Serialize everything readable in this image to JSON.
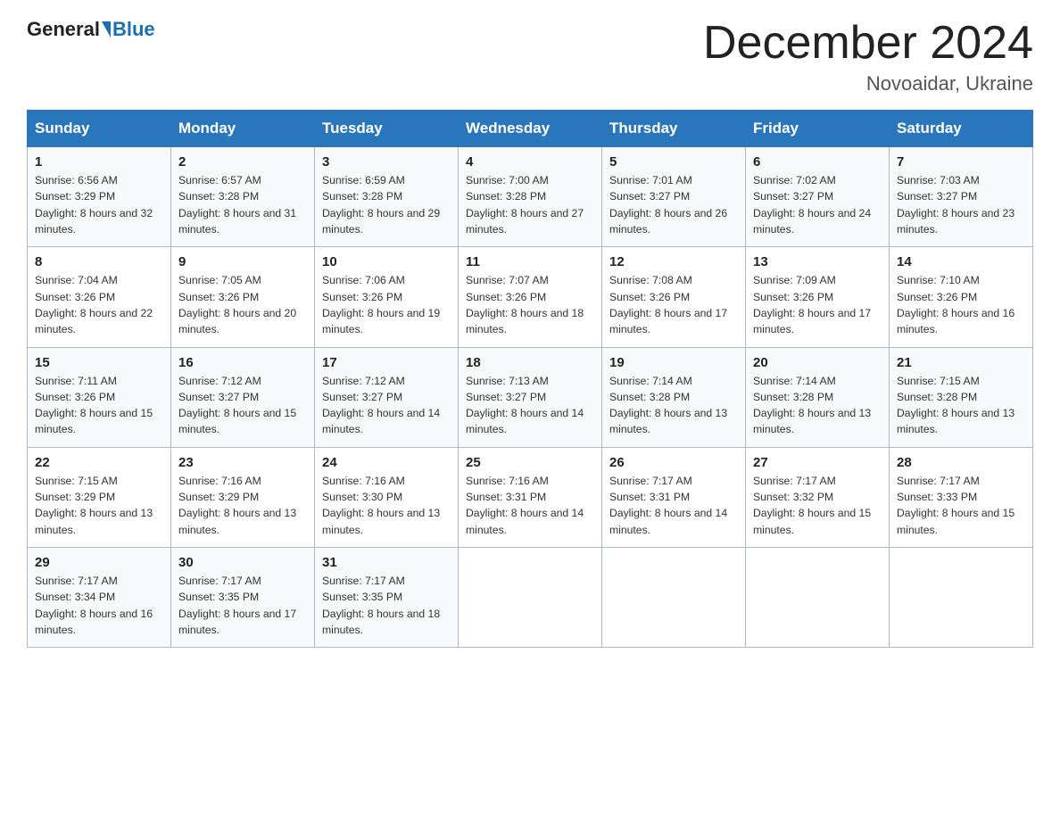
{
  "logo": {
    "general": "General",
    "blue": "Blue"
  },
  "title": "December 2024",
  "location": "Novoaidar, Ukraine",
  "weekdays": [
    "Sunday",
    "Monday",
    "Tuesday",
    "Wednesday",
    "Thursday",
    "Friday",
    "Saturday"
  ],
  "weeks": [
    [
      {
        "day": "1",
        "sunrise": "Sunrise: 6:56 AM",
        "sunset": "Sunset: 3:29 PM",
        "daylight": "Daylight: 8 hours and 32 minutes."
      },
      {
        "day": "2",
        "sunrise": "Sunrise: 6:57 AM",
        "sunset": "Sunset: 3:28 PM",
        "daylight": "Daylight: 8 hours and 31 minutes."
      },
      {
        "day": "3",
        "sunrise": "Sunrise: 6:59 AM",
        "sunset": "Sunset: 3:28 PM",
        "daylight": "Daylight: 8 hours and 29 minutes."
      },
      {
        "day": "4",
        "sunrise": "Sunrise: 7:00 AM",
        "sunset": "Sunset: 3:28 PM",
        "daylight": "Daylight: 8 hours and 27 minutes."
      },
      {
        "day": "5",
        "sunrise": "Sunrise: 7:01 AM",
        "sunset": "Sunset: 3:27 PM",
        "daylight": "Daylight: 8 hours and 26 minutes."
      },
      {
        "day": "6",
        "sunrise": "Sunrise: 7:02 AM",
        "sunset": "Sunset: 3:27 PM",
        "daylight": "Daylight: 8 hours and 24 minutes."
      },
      {
        "day": "7",
        "sunrise": "Sunrise: 7:03 AM",
        "sunset": "Sunset: 3:27 PM",
        "daylight": "Daylight: 8 hours and 23 minutes."
      }
    ],
    [
      {
        "day": "8",
        "sunrise": "Sunrise: 7:04 AM",
        "sunset": "Sunset: 3:26 PM",
        "daylight": "Daylight: 8 hours and 22 minutes."
      },
      {
        "day": "9",
        "sunrise": "Sunrise: 7:05 AM",
        "sunset": "Sunset: 3:26 PM",
        "daylight": "Daylight: 8 hours and 20 minutes."
      },
      {
        "day": "10",
        "sunrise": "Sunrise: 7:06 AM",
        "sunset": "Sunset: 3:26 PM",
        "daylight": "Daylight: 8 hours and 19 minutes."
      },
      {
        "day": "11",
        "sunrise": "Sunrise: 7:07 AM",
        "sunset": "Sunset: 3:26 PM",
        "daylight": "Daylight: 8 hours and 18 minutes."
      },
      {
        "day": "12",
        "sunrise": "Sunrise: 7:08 AM",
        "sunset": "Sunset: 3:26 PM",
        "daylight": "Daylight: 8 hours and 17 minutes."
      },
      {
        "day": "13",
        "sunrise": "Sunrise: 7:09 AM",
        "sunset": "Sunset: 3:26 PM",
        "daylight": "Daylight: 8 hours and 17 minutes."
      },
      {
        "day": "14",
        "sunrise": "Sunrise: 7:10 AM",
        "sunset": "Sunset: 3:26 PM",
        "daylight": "Daylight: 8 hours and 16 minutes."
      }
    ],
    [
      {
        "day": "15",
        "sunrise": "Sunrise: 7:11 AM",
        "sunset": "Sunset: 3:26 PM",
        "daylight": "Daylight: 8 hours and 15 minutes."
      },
      {
        "day": "16",
        "sunrise": "Sunrise: 7:12 AM",
        "sunset": "Sunset: 3:27 PM",
        "daylight": "Daylight: 8 hours and 15 minutes."
      },
      {
        "day": "17",
        "sunrise": "Sunrise: 7:12 AM",
        "sunset": "Sunset: 3:27 PM",
        "daylight": "Daylight: 8 hours and 14 minutes."
      },
      {
        "day": "18",
        "sunrise": "Sunrise: 7:13 AM",
        "sunset": "Sunset: 3:27 PM",
        "daylight": "Daylight: 8 hours and 14 minutes."
      },
      {
        "day": "19",
        "sunrise": "Sunrise: 7:14 AM",
        "sunset": "Sunset: 3:28 PM",
        "daylight": "Daylight: 8 hours and 13 minutes."
      },
      {
        "day": "20",
        "sunrise": "Sunrise: 7:14 AM",
        "sunset": "Sunset: 3:28 PM",
        "daylight": "Daylight: 8 hours and 13 minutes."
      },
      {
        "day": "21",
        "sunrise": "Sunrise: 7:15 AM",
        "sunset": "Sunset: 3:28 PM",
        "daylight": "Daylight: 8 hours and 13 minutes."
      }
    ],
    [
      {
        "day": "22",
        "sunrise": "Sunrise: 7:15 AM",
        "sunset": "Sunset: 3:29 PM",
        "daylight": "Daylight: 8 hours and 13 minutes."
      },
      {
        "day": "23",
        "sunrise": "Sunrise: 7:16 AM",
        "sunset": "Sunset: 3:29 PM",
        "daylight": "Daylight: 8 hours and 13 minutes."
      },
      {
        "day": "24",
        "sunrise": "Sunrise: 7:16 AM",
        "sunset": "Sunset: 3:30 PM",
        "daylight": "Daylight: 8 hours and 13 minutes."
      },
      {
        "day": "25",
        "sunrise": "Sunrise: 7:16 AM",
        "sunset": "Sunset: 3:31 PM",
        "daylight": "Daylight: 8 hours and 14 minutes."
      },
      {
        "day": "26",
        "sunrise": "Sunrise: 7:17 AM",
        "sunset": "Sunset: 3:31 PM",
        "daylight": "Daylight: 8 hours and 14 minutes."
      },
      {
        "day": "27",
        "sunrise": "Sunrise: 7:17 AM",
        "sunset": "Sunset: 3:32 PM",
        "daylight": "Daylight: 8 hours and 15 minutes."
      },
      {
        "day": "28",
        "sunrise": "Sunrise: 7:17 AM",
        "sunset": "Sunset: 3:33 PM",
        "daylight": "Daylight: 8 hours and 15 minutes."
      }
    ],
    [
      {
        "day": "29",
        "sunrise": "Sunrise: 7:17 AM",
        "sunset": "Sunset: 3:34 PM",
        "daylight": "Daylight: 8 hours and 16 minutes."
      },
      {
        "day": "30",
        "sunrise": "Sunrise: 7:17 AM",
        "sunset": "Sunset: 3:35 PM",
        "daylight": "Daylight: 8 hours and 17 minutes."
      },
      {
        "day": "31",
        "sunrise": "Sunrise: 7:17 AM",
        "sunset": "Sunset: 3:35 PM",
        "daylight": "Daylight: 8 hours and 18 minutes."
      },
      null,
      null,
      null,
      null
    ]
  ]
}
